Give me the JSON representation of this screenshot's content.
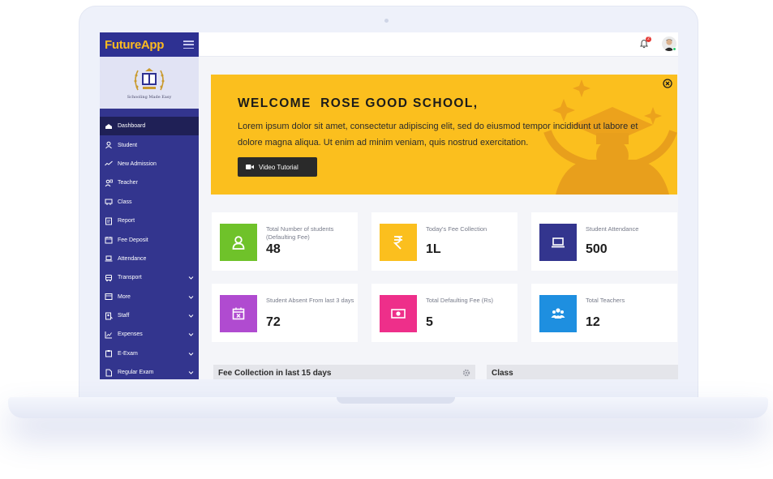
{
  "app": {
    "brand": "FutureApp",
    "school_tagline": "Schooling Made Easy"
  },
  "sidebar": {
    "items": [
      {
        "label": "Dashboard",
        "icon": "dashboard-icon",
        "active": true,
        "has_submenu": false
      },
      {
        "label": "Student",
        "icon": "user-icon",
        "has_submenu": false
      },
      {
        "label": "New Admission",
        "icon": "trend-icon",
        "has_submenu": false
      },
      {
        "label": "Teacher",
        "icon": "teacher-icon",
        "has_submenu": false
      },
      {
        "label": "Class",
        "icon": "class-icon",
        "has_submenu": false
      },
      {
        "label": "Report",
        "icon": "report-icon",
        "has_submenu": false
      },
      {
        "label": "Fee Deposit",
        "icon": "calendar-icon",
        "has_submenu": false
      },
      {
        "label": "Attendance",
        "icon": "laptop-icon",
        "has_submenu": false
      },
      {
        "label": "Transport",
        "icon": "bus-icon",
        "has_submenu": true
      },
      {
        "label": "More",
        "icon": "more-icon",
        "has_submenu": true
      },
      {
        "label": "Staff",
        "icon": "staff-icon",
        "has_submenu": true
      },
      {
        "label": "Expenses",
        "icon": "chart-icon",
        "has_submenu": true
      },
      {
        "label": "E-Exam",
        "icon": "exam-icon",
        "has_submenu": true
      },
      {
        "label": "Regular Exam",
        "icon": "document-icon",
        "has_submenu": true
      }
    ]
  },
  "topbar": {
    "notification_count": "2"
  },
  "banner": {
    "title": "WELCOME  ROSE GOOD SCHOOL,",
    "text": "Lorem ipsum dolor sit amet, consectetur adipiscing elit, sed do eiusmod tempor incididunt ut labore et dolore magna aliqua. Ut enim ad minim veniam, quis nostrud exercitation.",
    "button_label": "Video Tutorial"
  },
  "cards": [
    {
      "label": "Total Number of students (Defaulting Fee)",
      "value": "48",
      "color": "#6fc22a",
      "icon": "user-icon"
    },
    {
      "label": "Today's Fee Collection",
      "value": "1L",
      "color": "#fbbf1e",
      "icon": "rupee-icon"
    },
    {
      "label": "Student Attendance",
      "value": "500",
      "color": "#33358e",
      "icon": "laptop-icon"
    },
    {
      "label": "Student Absent From last 3 days",
      "value": "72",
      "color": "#b04bd0",
      "icon": "calendar-x-icon"
    },
    {
      "label": "Total Defaulting Fee (Rs)",
      "value": "5",
      "color": "#ee2f8a",
      "icon": "money-icon"
    },
    {
      "label": "Total Teachers",
      "value": "12",
      "color": "#1e8fe0",
      "icon": "group-icon"
    }
  ],
  "panels": {
    "fee_title": "Fee Collection in last 15 days",
    "class_title": "Class"
  },
  "colors": {
    "sidebar": "#33358e",
    "accent": "#fbbf1e",
    "brand_text": "#fdbb1f"
  }
}
